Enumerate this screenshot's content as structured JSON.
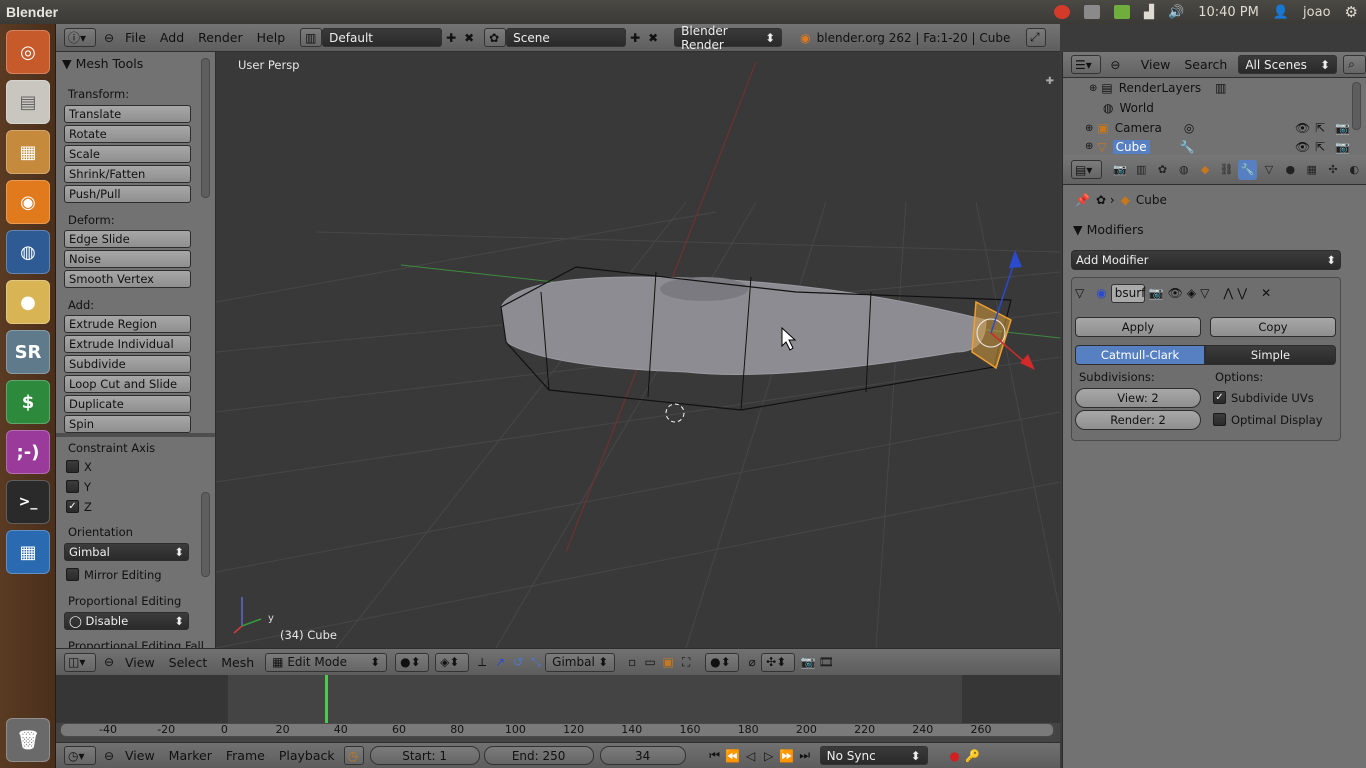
{
  "system": {
    "app_title": "Blender",
    "time": "10:40 PM",
    "user": "joao"
  },
  "launcher": {
    "items": [
      "ubuntu-home",
      "files",
      "archive-manager",
      "firefox",
      "blender",
      "cookie-app",
      "sr-app",
      "money-app",
      "chat-app",
      "terminal",
      "workspace-switcher",
      "trash"
    ]
  },
  "info_header": {
    "menus": [
      "File",
      "Add",
      "Render",
      "Help"
    ],
    "screen_layout": "Default",
    "scene": "Scene",
    "render_engine": "Blender Render",
    "stats": "blender.org 262 | Fa:1-20 | Cube"
  },
  "toolshelf": {
    "title": "Mesh Tools",
    "transform_label": "Transform:",
    "transform": [
      "Translate",
      "Rotate",
      "Scale",
      "Shrink/Fatten",
      "Push/Pull"
    ],
    "deform_label": "Deform:",
    "deform": [
      "Edge Slide",
      "Noise",
      "Smooth Vertex"
    ],
    "add_label": "Add:",
    "add": [
      "Extrude Region",
      "Extrude Individual",
      "Subdivide",
      "Loop Cut and Slide",
      "Duplicate",
      "Spin"
    ],
    "constraint_axis_label": "Constraint Axis",
    "axes": [
      {
        "label": "X",
        "checked": false
      },
      {
        "label": "Y",
        "checked": false
      },
      {
        "label": "Z",
        "checked": true
      }
    ],
    "orientation_label": "Orientation",
    "orientation_value": "Gimbal",
    "mirror_label": "Mirror Editing",
    "prop_edit_label": "Proportional Editing",
    "prop_edit_value": "Disable",
    "prop_falloff_label": "Proportional Editing Fall"
  },
  "viewport": {
    "view_label": "User Persp",
    "object_label": "(34) Cube",
    "axis_y": "y"
  },
  "viewport_header": {
    "menus": [
      "View",
      "Select",
      "Mesh"
    ],
    "mode": "Edit Mode",
    "orientation": "Gimbal"
  },
  "timeline": {
    "ticks": [
      "-40",
      "-20",
      "0",
      "20",
      "40",
      "60",
      "80",
      "100",
      "120",
      "140",
      "160",
      "180",
      "200",
      "220",
      "240",
      "260"
    ],
    "current_frame": 34,
    "menus": [
      "View",
      "Marker",
      "Frame",
      "Playback"
    ],
    "start_label": "Start: 1",
    "end_label": "End: 250",
    "frame_value": "34",
    "sync": "No Sync"
  },
  "outliner": {
    "menus": [
      "View",
      "Search"
    ],
    "filter": "All Scenes",
    "rows": [
      "RenderLayers",
      "World",
      "Camera",
      "Cube"
    ]
  },
  "properties": {
    "breadcrumb": "Cube",
    "modifiers_title": "Modifiers",
    "add_modifier": "Add Modifier",
    "modifier_name": "bsurf",
    "apply": "Apply",
    "copy": "Copy",
    "type_catmull": "Catmull-Clark",
    "type_simple": "Simple",
    "subdivisions_label": "Subdivisions:",
    "options_label": "Options:",
    "view_levels": "View: 2",
    "render_levels": "Render: 2",
    "subdivide_uvs": "Subdivide UVs",
    "optimal_display": "Optimal Display"
  },
  "colors": {
    "accent_blue": "#5680c2",
    "selected_orange": "#f0a030",
    "grid": "#4a4a4a",
    "x_axis": "#8a3030",
    "y_axis": "#3a8a3a"
  }
}
